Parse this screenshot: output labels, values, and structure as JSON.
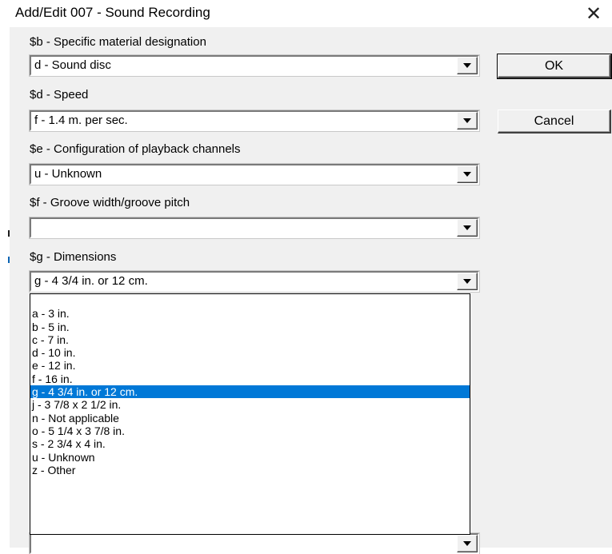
{
  "window": {
    "title": "Add/Edit 007 - Sound Recording",
    "close_glyph": "✕"
  },
  "fields": [
    {
      "label": "$b - Specific material designation",
      "value": "d - Sound disc"
    },
    {
      "label": "$d - Speed",
      "value": "f - 1.4 m. per sec."
    },
    {
      "label": "$e - Configuration of playback channels",
      "value": "u - Unknown"
    },
    {
      "label": "$f - Groove width/groove pitch",
      "value": ""
    },
    {
      "label": "$g - Dimensions",
      "value": "g - 4 3/4 in. or 12 cm."
    }
  ],
  "buttons": {
    "ok_label": "OK",
    "cancel_label": "Cancel"
  },
  "dropdown": {
    "items": [
      "",
      "a - 3 in.",
      "b - 5 in.",
      "c - 7 in.",
      "d - 10 in.",
      "e - 12 in.",
      "f - 16 in.",
      "g - 4 3/4 in. or 12 cm.",
      "j - 3 7/8 x 2 1/2 in.",
      "n - Not applicable",
      "o - 5 1/4 x 3 7/8 in.",
      "s - 2 3/4 x 4 in.",
      "u - Unknown",
      "z - Other"
    ],
    "selected_index": 7
  },
  "colors": {
    "selection_bg": "#0078d7",
    "dialog_bg": "#f0f0f0"
  }
}
